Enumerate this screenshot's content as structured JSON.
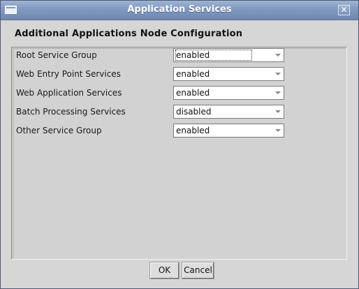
{
  "window": {
    "title": "Application Services",
    "close_glyph": "✕"
  },
  "dialog": {
    "heading": "Additional Applications Node Configuration",
    "rows": [
      {
        "label": "Root Service Group",
        "value": "enabled"
      },
      {
        "label": "Web Entry Point Services",
        "value": "enabled"
      },
      {
        "label": "Web Application Services",
        "value": "enabled"
      },
      {
        "label": "Batch Processing Services",
        "value": "disabled"
      },
      {
        "label": "Other Service Group",
        "value": "enabled"
      }
    ]
  },
  "buttons": {
    "ok_label": "OK",
    "cancel_label": "Cancel"
  },
  "colors": {
    "titlebar": "#7f98be",
    "dialog_background": "#d6d6d6"
  }
}
